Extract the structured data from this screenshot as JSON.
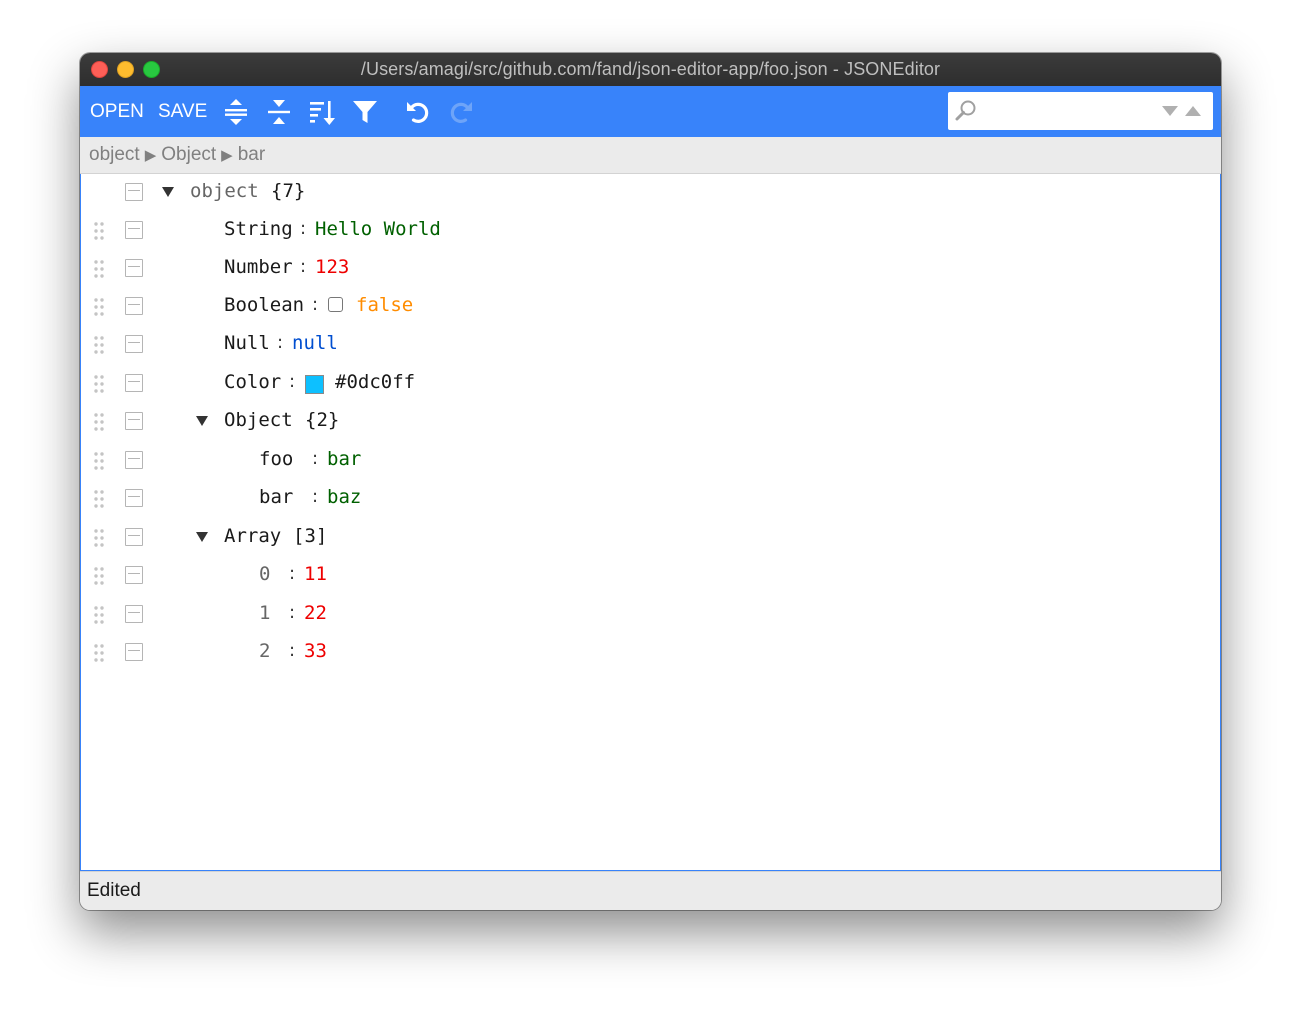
{
  "window": {
    "title": "/Users/amagi/src/github.com/fand/json-editor-app/foo.json - JSONEditor"
  },
  "toolbar": {
    "open_label": "OPEN",
    "save_label": "SAVE",
    "icons": [
      "expand-all-icon",
      "collapse-all-icon",
      "sort-icon",
      "filter-icon",
      "undo-icon",
      "redo-icon"
    ],
    "accent_color": "#3883fa"
  },
  "search": {
    "value": "",
    "placeholder": ""
  },
  "breadcrumb": {
    "items": [
      "object",
      "Object",
      "bar"
    ]
  },
  "tree": {
    "root": {
      "key": "object",
      "count": "{7}"
    },
    "string": {
      "key": "String",
      "value": "Hello World"
    },
    "number": {
      "key": "Number",
      "value": "123"
    },
    "boolean": {
      "key": "Boolean",
      "value": "false",
      "checked": false
    },
    "null": {
      "key": "Null",
      "value": "null"
    },
    "color": {
      "key": "Color",
      "value": "#0dc0ff",
      "swatch": "#0dc0ff"
    },
    "object": {
      "key": "Object",
      "count": "{2}"
    },
    "foo": {
      "key": "foo",
      "value": "bar"
    },
    "bar": {
      "key": "bar",
      "value": "baz"
    },
    "array": {
      "key": "Array",
      "count": "[3]"
    },
    "item0": {
      "key": "0",
      "value": "11"
    },
    "item1": {
      "key": "1",
      "value": "22"
    },
    "item2": {
      "key": "2",
      "value": "33"
    }
  },
  "status": {
    "text": "Edited"
  }
}
